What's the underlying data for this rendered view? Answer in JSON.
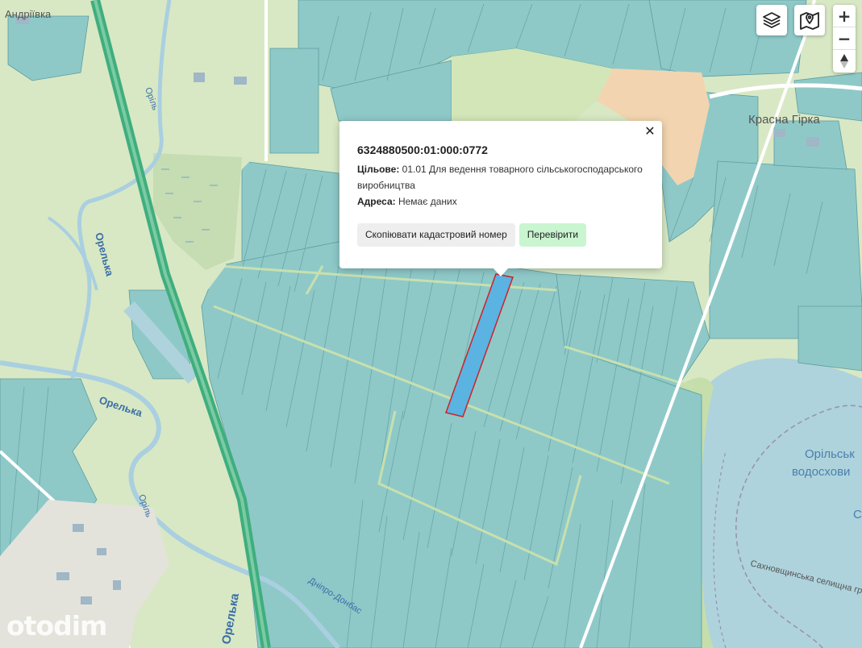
{
  "map": {
    "labels": {
      "village_top_left": "Андріївка",
      "village_right": "Красна Гірка",
      "river_orel_upper": "Оріль",
      "river_orelka_vertical": "Орелька",
      "river_orelka_vertical_small": "Оріль",
      "river_orelka_mid": "Орелька",
      "river_orel_lower": "Оріль",
      "river_orelka_bottom": "Орелька",
      "canal": "Дніпро-Донбас",
      "reservoir": "Орільське водосховище",
      "reservoir_line1": "Орільськ",
      "reservoir_line2": "водосхови",
      "boundary": "Сахновщинська селищна громада",
      "edge_letter": "С"
    },
    "colors": {
      "parcel_fill": "#8ec9c8",
      "parcel_stroke": "#5d9c9e",
      "selected_parcel_fill": "#5ab3e0",
      "selected_parcel_stroke": "#d0212a",
      "field_green": "#cfe3b6",
      "water": "#aed3dc",
      "railway": "#3fae7f",
      "sand": "#f2d5b0"
    }
  },
  "popup": {
    "cadastral_number": "6324880500:01:000:0772",
    "purpose_label": "Цільове:",
    "purpose_value": "01.01 Для ведення товарного сільськогосподарського виробництва",
    "address_label": "Адреса:",
    "address_value": "Немає даних",
    "copy_button": "Скопіювати кадастровий номер",
    "check_button": "Перевірити",
    "close_glyph": "✕"
  },
  "controls": {
    "layers_icon": "layers-icon",
    "map_icon": "map-marker-icon",
    "zoom_in": "+",
    "zoom_out": "−",
    "compass": "compass-icon"
  },
  "watermark": "otodim"
}
